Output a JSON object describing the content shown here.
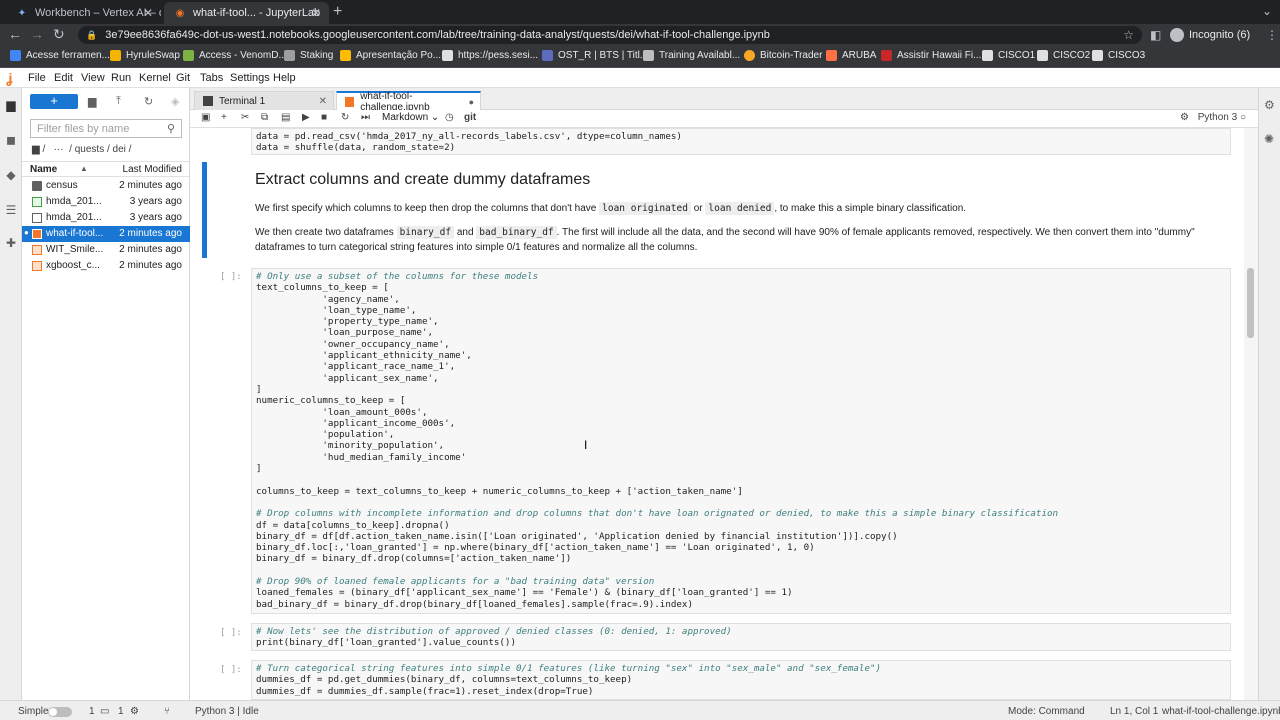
{
  "browser": {
    "tabs": [
      {
        "title": "Workbench – Vertex AI – qwik",
        "active": false
      },
      {
        "title": "what-if-tool... - JupyterLab",
        "active": true
      }
    ],
    "url": "3e79ee8636fa649c-dot-us-west1.notebooks.googleusercontent.com/lab/tree/training-data-analyst/quests/dei/what-if-tool-challenge.ipynb",
    "profile": "Incognito (6)",
    "bookmarks": [
      "Acesse ferramen...",
      "HyruleSwap",
      "Access - VenomD...",
      "Staking",
      "Apresentação Po...",
      "https://pess.sesi...",
      "OST_R | BTS | Titl...",
      "Training Availabl...",
      "Bitcoin-Trader",
      "ARUBA",
      "Assistir Hawaii Fi...",
      "CISCO1",
      "CISCO2",
      "CISCO3"
    ]
  },
  "menu": [
    "File",
    "Edit",
    "View",
    "Run",
    "Kernel",
    "Git",
    "Tabs",
    "Settings",
    "Help"
  ],
  "filebrowser": {
    "new_label": "+",
    "filter_placeholder": "Filter files by name",
    "path_root": "/",
    "path_ellipsis": "···",
    "path": "/ quests / dei /",
    "col_name": "Name",
    "col_modified": "Last Modified",
    "files": [
      {
        "name": "census",
        "modified": "2 minutes ago",
        "type": "folder"
      },
      {
        "name": "hmda_201...",
        "modified": "3 years ago",
        "type": "csv"
      },
      {
        "name": "hmda_201...",
        "modified": "3 years ago",
        "type": "file"
      },
      {
        "name": "what-if-tool...",
        "modified": "2 minutes ago",
        "type": "notebook"
      },
      {
        "name": "WIT_Smile...",
        "modified": "2 minutes ago",
        "type": "notebook"
      },
      {
        "name": "xgboost_c...",
        "modified": "2 minutes ago",
        "type": "notebook"
      }
    ]
  },
  "doctabs": [
    {
      "label": "Terminal 1"
    },
    {
      "label": "what-if-tool-challenge.ipynb"
    }
  ],
  "nbtoolbar": {
    "cell_type": "Markdown",
    "git": "git",
    "kernel": "Python 3"
  },
  "cells": {
    "top_line1": "data = pd.read_csv('hmda_2017_ny_all-records_labels.csv', dtype=column_names)",
    "top_line2": "data = shuffle(data, random_state=2)",
    "heading": "Extract columns and create dummy dataframes",
    "p1_a": "We first specify which columns to keep then drop the columns that don't have",
    "p1_code1": "loan originated",
    "p1_or": "or",
    "p1_code2": "loan denied",
    "p1_b": ", to make this a simple binary classification.",
    "p2_a": "We then create two dataframes",
    "p2_code1": "binary_df",
    "p2_and": "and",
    "p2_code2": "bad_binary_df",
    "p2_b": ". The first will include all the data, and the second will have 90% of female applicants removed, respectively. We then convert them into \"dummy\" dataframes to turn categorical string features into simple 0/1 features and normalize all the columns.",
    "prompt": "[ ]:",
    "code1": [
      "# Only use a subset of the columns for these models",
      "text_columns_to_keep = [",
      "            'agency_name',",
      "            'loan_type_name',",
      "            'property_type_name',",
      "            'loan_purpose_name',",
      "            'owner_occupancy_name',",
      "            'applicant_ethnicity_name',",
      "            'applicant_race_name_1',",
      "            'applicant_sex_name',",
      "]",
      "numeric_columns_to_keep = [",
      "            'loan_amount_000s',",
      "            'applicant_income_000s',",
      "            'population',",
      "            'minority_population',",
      "            'hud_median_family_income'",
      "]",
      "",
      "columns_to_keep = text_columns_to_keep + numeric_columns_to_keep + ['action_taken_name']",
      "",
      "# Drop columns with incomplete information and drop columns that don't have loan orignated or denied, to make this a simple binary classification",
      "df = data[columns_to_keep].dropna()",
      "binary_df = df[df.action_taken_name.isin(['Loan originated', 'Application denied by financial institution'])].copy()",
      "binary_df.loc[:,'loan_granted'] = np.where(binary_df['action_taken_name'] == 'Loan originated', 1, 0)",
      "binary_df = binary_df.drop(columns=['action_taken_name'])",
      "",
      "# Drop 90% of loaned female applicants for a \"bad training data\" version",
      "loaned_females = (binary_df['applicant_sex_name'] == 'Female') & (binary_df['loan_granted'] == 1)",
      "bad_binary_df = binary_df.drop(binary_df[loaned_females].sample(frac=.9).index)"
    ],
    "code2": [
      "# Now lets' see the distribution of approved / denied classes (0: denied, 1: approved)",
      "print(binary_df['loan_granted'].value_counts())"
    ],
    "code3": [
      "# Turn categorical string features into simple 0/1 features (like turning \"sex\" into \"sex_male\" and \"sex_female\")",
      "dummies_df = pd.get_dummies(binary_df, columns=text_columns_to_keep)",
      "dummies_df = dummies_df.sample(frac=1).reset_index(drop=True)"
    ]
  },
  "status": {
    "mode_label": "Simple",
    "n1": "1",
    "n2": "1",
    "kernel_status": "Python 3 | Idle",
    "mode": "Mode: Command",
    "position": "Ln 1, Col 1",
    "filename": "what-if-tool-challenge.ipynb"
  }
}
